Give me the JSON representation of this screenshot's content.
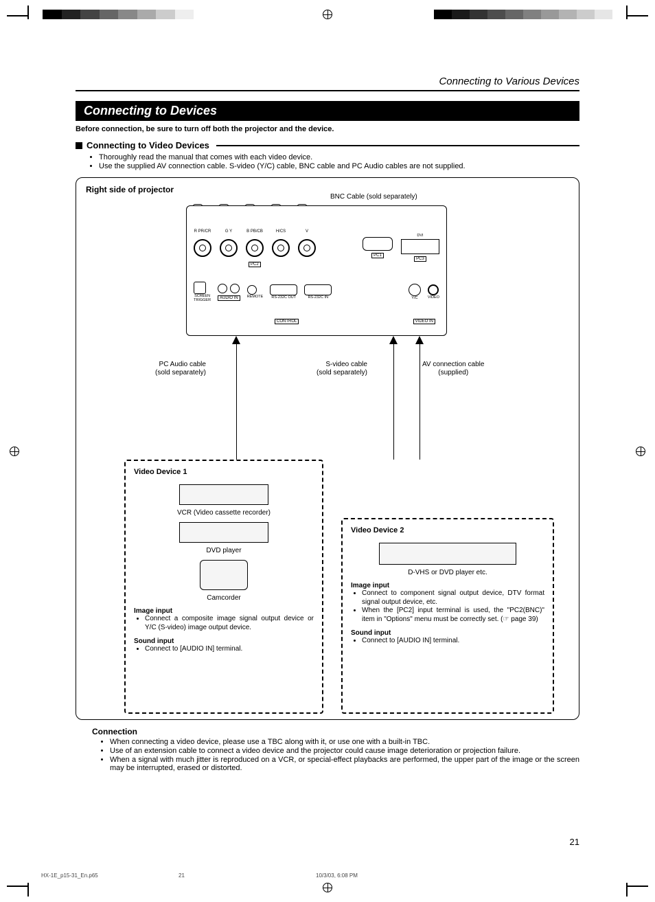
{
  "running_head": "Connecting to Various Devices",
  "section_title": "Connecting to Devices",
  "intro": "Before connection, be sure to turn off both the projector and the device.",
  "subhead": "Connecting to Video Devices",
  "sub_bullets": [
    "Thoroughly read the manual that comes with each video device.",
    "Use the supplied AV connection cable. S-video (Y/C) cable, BNC cable and PC Audio cables are not supplied."
  ],
  "diagram": {
    "title": "Right side of projector",
    "bnc_cable": "BNC Cable (sold separately)",
    "ports": {
      "bnc": [
        "R PR/CR",
        "G Y",
        "B PB/CB",
        "H/CS",
        "V"
      ],
      "pc1": "PC1",
      "pc2": "PC2",
      "pc3": "PC3",
      "dvi": "DVI",
      "screen_trigger": "SCREEN\nTRIGGER",
      "audio_in": "AUDIO IN",
      "remote": "REMOTE",
      "rs232_out": "RS-232C OUT",
      "rs232_in": "RS-232C IN",
      "control": "CONTROL",
      "yc": "Y/C",
      "video": "VIDEO",
      "video_in": "VIDEO IN"
    },
    "cables": {
      "pc_audio": "PC Audio cable\n(sold separately)",
      "svideo": "S-video cable\n(sold separately)",
      "av": "AV connection cable\n(supplied)"
    },
    "device1": {
      "title": "Video Device 1",
      "vcr": "VCR (Video cassette recorder)",
      "dvd": "DVD player",
      "cam": "Camcorder",
      "image_input_h": "Image input",
      "image_input": "Connect a composite image signal output device or Y/C (S-video) image output device.",
      "sound_input_h": "Sound input",
      "sound_input": "Connect to [AUDIO IN] terminal."
    },
    "device2": {
      "title": "Video Device 2",
      "caption": "D-VHS or DVD player etc.",
      "image_input_h": "Image input",
      "image_input_1": "Connect to component signal output device, DTV format signal output device, etc.",
      "image_input_2": "When the [PC2] input terminal is used, the \"PC2(BNC)\" item in \"Options\" menu must be correctly set. (☞ page 39)",
      "sound_input_h": "Sound input",
      "sound_input": "Connect to [AUDIO IN] terminal."
    }
  },
  "connection_h": "Connection",
  "connection_bullets": [
    "When connecting a video device, please use a TBC along with it, or use one with a built-in TBC.",
    "Use of an extension cable to connect a video device and the projector could cause image deterioration or projection failure.",
    "When a signal with much jitter is reproduced on a VCR, or special-effect playbacks are performed, the upper part of the image or the screen may be interrupted, erased or distorted."
  ],
  "page_number": "21",
  "footer": {
    "file": "HX-1E_p15-31_En.p65",
    "page": "21",
    "datetime": "10/3/03, 6:08 PM"
  }
}
